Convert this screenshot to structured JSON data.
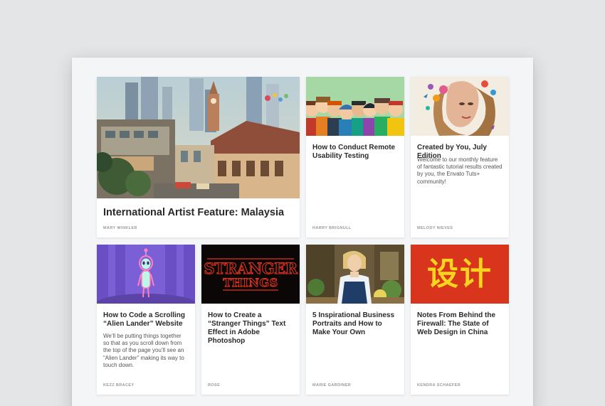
{
  "cards": [
    {
      "title": "International Artist Feature: Malaysia",
      "description": "",
      "author": "MARY WINKLER",
      "image": "malaysia-cityscape-illustration"
    },
    {
      "title": "How to Conduct Remote Usability Testing",
      "description": "",
      "author": "HARRY BRIGNULL",
      "image": "cartoon-people-group-illustration"
    },
    {
      "title": "Created by You, July Edition",
      "description": "Welcome to our monthly feature of fantastic tutorial results created by you, the Envato Tuts+ community!",
      "author": "MELODY NIEVES",
      "image": "floral-portrait-illustration"
    },
    {
      "title": "How to Code a Scrolling “Alien Lander” Website",
      "description": "We’ll be putting things together so that as you scroll down from the top of the page you’ll see an “Alien Lander” making its way to touch down.",
      "author": "KEZZ BRACEY",
      "image": "alien-lander-illustration"
    },
    {
      "title": "How to Create a “Stranger Things” Text Effect in Adobe Photoshop",
      "description": "",
      "author": "ROSE",
      "image": "stranger-things-text-effect",
      "image_text_line1": "STRANGER",
      "image_text_line2": "THINGS"
    },
    {
      "title": "5 Inspirational Business Portraits and How to Make Your Own",
      "description": "",
      "author": "MARIE GARDINER",
      "image": "business-woman-portrait-photo"
    },
    {
      "title": "Notes From Behind the Firewall: The State of Web Design in China",
      "description": "",
      "author": "KENDRA SCHAEFER",
      "image": "chinese-characters-design",
      "image_text": "设计"
    }
  ],
  "colors": {
    "page_background": "#e4e5e7",
    "sheet_background": "#f4f5f7",
    "card_background": "#ffffff",
    "title_text": "#2a2a2a",
    "author_text": "#9a9a9a",
    "china_red": "#d9341c",
    "china_yellow": "#f7d51e",
    "stranger_red": "#e3321c"
  }
}
